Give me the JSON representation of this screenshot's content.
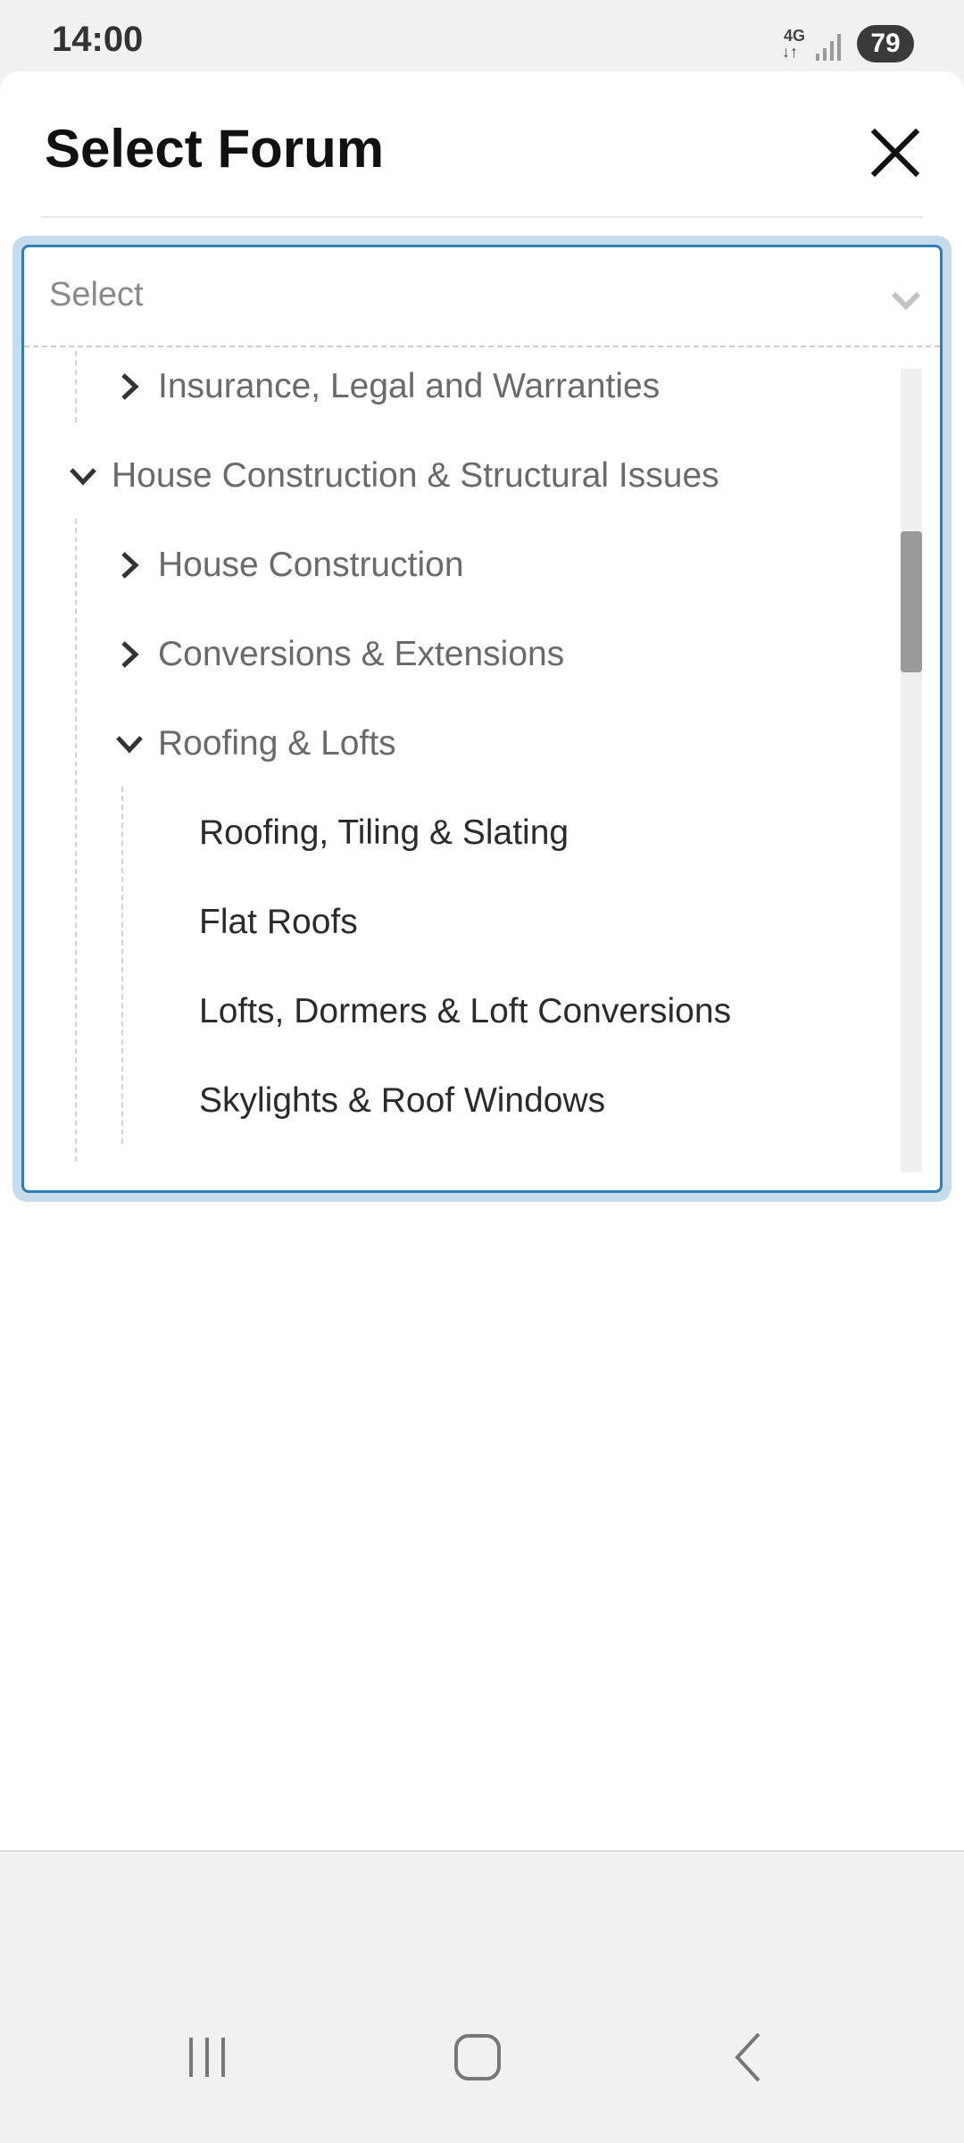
{
  "status_bar": {
    "time": "14:00",
    "network_top": "4G",
    "network_bottom": "↓↑",
    "battery": "79"
  },
  "sheet": {
    "title": "Select Forum"
  },
  "select": {
    "placeholder": "Select"
  },
  "tree": {
    "items": [
      {
        "label": "Insurance, Legal and Warranties",
        "level": 1,
        "expanded": false
      },
      {
        "label": "House Construction & Structural Issues",
        "level": 0,
        "expanded": true
      },
      {
        "label": "House Construction",
        "level": 1,
        "expanded": false
      },
      {
        "label": "Conversions & Extensions",
        "level": 1,
        "expanded": false
      },
      {
        "label": "Roofing & Lofts",
        "level": 1,
        "expanded": true
      },
      {
        "label": "Roofing, Tiling & Slating",
        "level": 2
      },
      {
        "label": "Flat Roofs",
        "level": 2
      },
      {
        "label": "Lofts, Dormers & Loft Conversions",
        "level": 2
      },
      {
        "label": "Skylights & Roof Windows",
        "level": 2
      }
    ]
  },
  "icons": {
    "close": "close-icon",
    "select_chevron": "chevron-down-icon",
    "collapsed": "chevron-right-icon",
    "expanded": "chevron-down-icon",
    "nav_recents": "recents-icon",
    "nav_home": "home-icon",
    "nav_back": "back-icon"
  },
  "colors": {
    "accent": "#2f7eb7",
    "focus_ring": "#c6dcec"
  }
}
